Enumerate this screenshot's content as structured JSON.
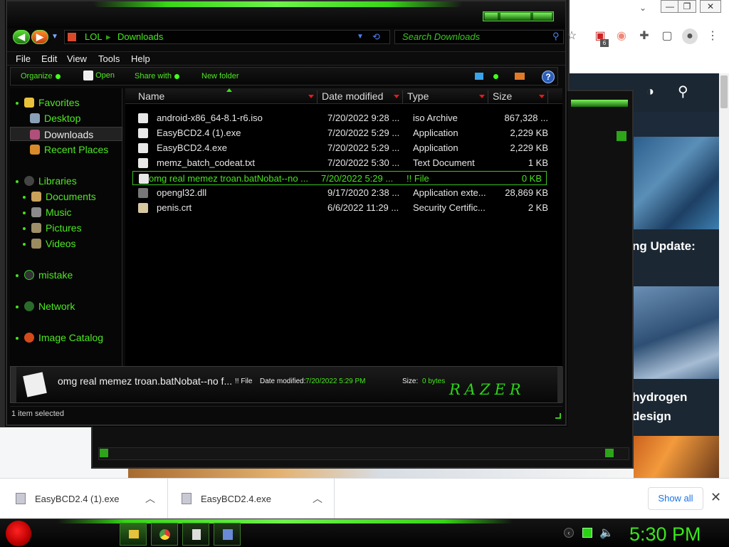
{
  "browser": {
    "extensions_badge": "6",
    "article_heading_1": "ng Update:",
    "article_heading_2": "hydrogen design"
  },
  "explorer": {
    "path": [
      "LOL",
      "Downloads"
    ],
    "search_placeholder": "Search Downloads",
    "menu": [
      "File",
      "Edit",
      "View",
      "Tools",
      "Help"
    ],
    "commands": [
      "Organize",
      "Open",
      "Share with",
      "New folder"
    ],
    "nav": [
      {
        "label": "Favorites",
        "level": 0,
        "icon": "star-icon"
      },
      {
        "label": "Desktop",
        "level": 1,
        "icon": "desktop-icon"
      },
      {
        "label": "Downloads",
        "level": 1,
        "icon": "downloads-icon",
        "selected": true
      },
      {
        "label": "Recent Places",
        "level": 1,
        "icon": "recent-places-icon"
      },
      {
        "label": "Libraries",
        "level": 0,
        "icon": "libraries-icon"
      },
      {
        "label": "Documents",
        "level": 1,
        "icon": "documents-icon"
      },
      {
        "label": "Music",
        "level": 1,
        "icon": "music-icon"
      },
      {
        "label": "Pictures",
        "level": 1,
        "icon": "pictures-icon"
      },
      {
        "label": "Videos",
        "level": 1,
        "icon": "videos-icon"
      },
      {
        "label": "mistake",
        "level": 0,
        "icon": "folder-icon"
      },
      {
        "label": "Network",
        "level": 0,
        "icon": "network-icon"
      },
      {
        "label": "Image Catalog",
        "level": 0,
        "icon": "image-catalog-icon"
      }
    ],
    "columns": [
      "Name",
      "Date modified",
      "Type",
      "Size"
    ],
    "files": [
      {
        "name": "android-x86_64-8.1-r6.iso",
        "date": "7/20/2022 9:28 ...",
        "type": "iso Archive",
        "size": "867,328 ..."
      },
      {
        "name": "EasyBCD2.4 (1).exe",
        "date": "7/20/2022 5:29 ...",
        "type": "Application",
        "size": "2,229 KB"
      },
      {
        "name": "EasyBCD2.4.exe",
        "date": "7/20/2022 5:29 ...",
        "type": "Application",
        "size": "2,229 KB"
      },
      {
        "name": "memz_batch_codeat.txt",
        "date": "7/20/2022 5:30 ...",
        "type": "Text Document",
        "size": "1 KB"
      },
      {
        "name": "omg real memez troan.batNobat--no ...",
        "date": "7/20/2022 5:29 ...",
        "type": "!! File",
        "size": "0 KB",
        "selected": true
      },
      {
        "name": "opengl32.dll",
        "date": "9/17/2020 2:38 ...",
        "type": "Application exte...",
        "size": "28,869 KB"
      },
      {
        "name": "penis.crt",
        "date": "6/6/2022 11:29 ...",
        "type": "Security Certific...",
        "size": "2 KB"
      }
    ],
    "details": {
      "filename": "omg real memez troan.batNobat--no f...",
      "type": "!! File",
      "date_label": "Date modified:",
      "date_value": "7/20/2022 5:29 PM",
      "size_label": "Size:",
      "size_value": "0 bytes",
      "logo": "RAZER"
    },
    "status": "1 item selected"
  },
  "downloads": {
    "items": [
      "EasyBCD2.4 (1).exe",
      "EasyBCD2.4.exe"
    ],
    "show_all": "Show all"
  },
  "taskbar": {
    "clock": "5:30 PM"
  },
  "colors": {
    "accent_green": "#44e11b",
    "window_bg": "#0a0a0a",
    "selection_border": "#3fc21e"
  }
}
